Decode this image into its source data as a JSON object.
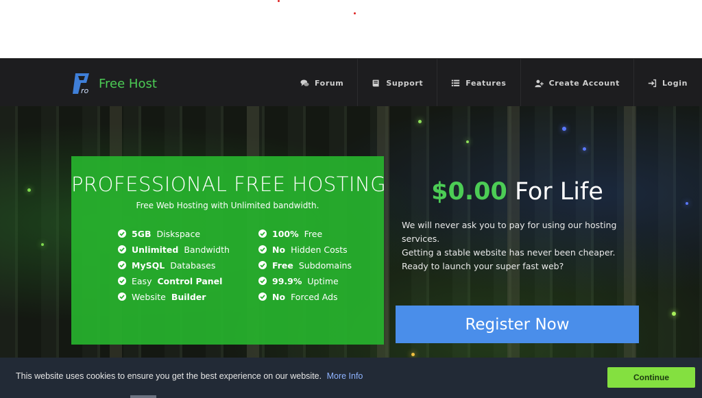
{
  "brand": {
    "name": "Free Host",
    "logo_letters": "ro"
  },
  "nav": [
    {
      "label": "Forum",
      "icon": "comments-icon"
    },
    {
      "label": "Support",
      "icon": "book-icon"
    },
    {
      "label": "Features",
      "icon": "list-icon"
    },
    {
      "label": "Create Account",
      "icon": "user-plus-icon"
    },
    {
      "label": "Login",
      "icon": "sign-in-icon"
    }
  ],
  "hero": {
    "title": "PROFESSIONAL  FREE  HOSTING",
    "subtitle": "Free Web Hosting with Unlimited bandwidth.",
    "features_left": [
      {
        "bold": "5GB",
        "rest": " Diskspace"
      },
      {
        "bold": "Unlimited",
        "rest": " Bandwidth"
      },
      {
        "bold": "MySQL",
        "rest": " Databases"
      },
      {
        "pre": "Easy ",
        "bold": "Control Panel",
        "rest": ""
      },
      {
        "pre": "Website ",
        "bold": "Builder",
        "rest": ""
      }
    ],
    "features_right": [
      {
        "bold": "100%",
        "rest": " Free"
      },
      {
        "bold": "No",
        "rest": " Hidden Costs"
      },
      {
        "bold": "Free",
        "rest": " Subdomains"
      },
      {
        "bold": "99.9%",
        "rest": " Uptime"
      },
      {
        "bold": "No",
        "rest": " Forced Ads"
      }
    ],
    "price_amount": "$0.00",
    "price_suffix": " For Life",
    "description_lines": [
      "We will never ask you to pay for using our hosting services.",
      "Getting a stable website has never been cheaper.",
      "Ready to launch your super fast web?"
    ],
    "register_label": "Register Now"
  },
  "cookie": {
    "message": "This website uses cookies to ensure you get the best experience on our website.",
    "link_label": "More Info",
    "button_label": "Continue"
  },
  "colors": {
    "accent_green": "#4ccc55",
    "panel_green": "#27b22d",
    "register_blue": "#4a8eea",
    "continue_green": "#84e040"
  }
}
